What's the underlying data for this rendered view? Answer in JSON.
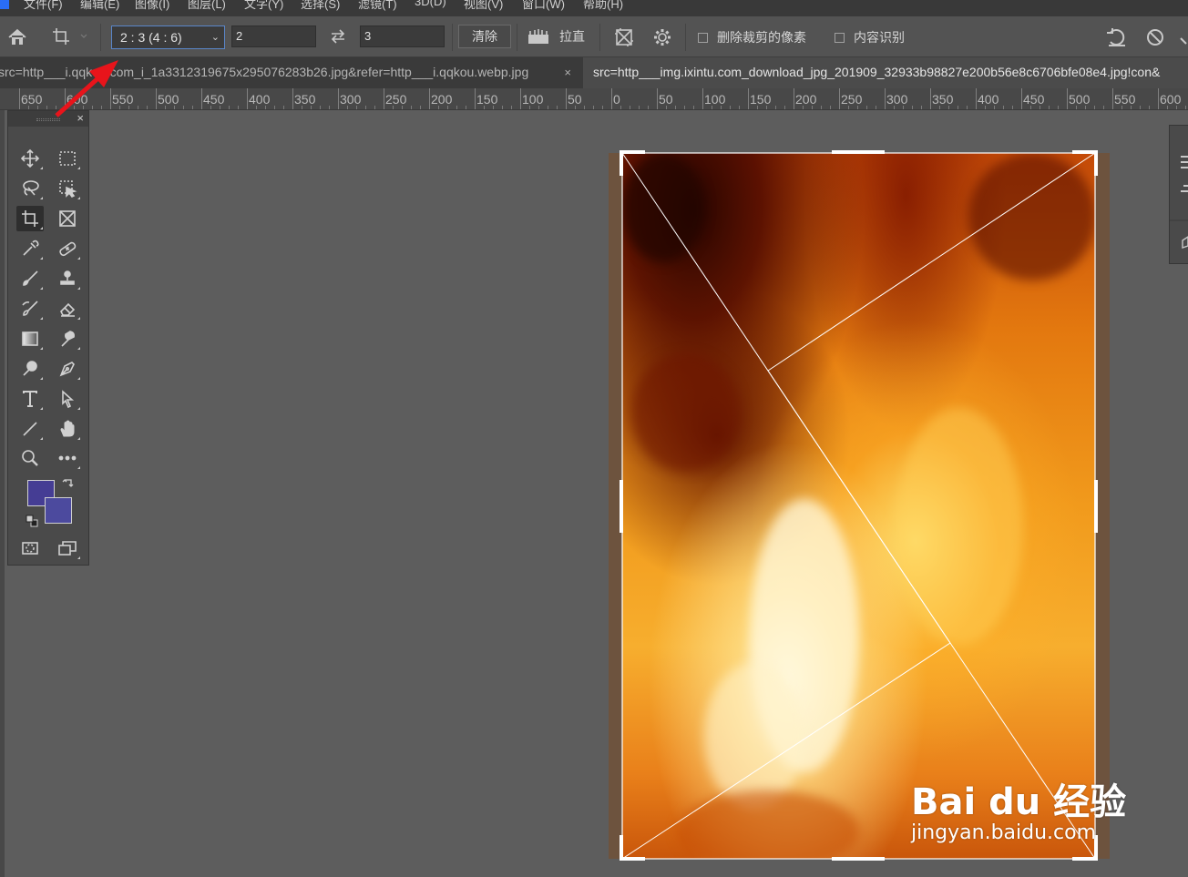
{
  "menubar": {
    "items": [
      "文件(F)",
      "编辑(E)",
      "图像(I)",
      "图层(L)",
      "文字(Y)",
      "选择(S)",
      "滤镜(T)",
      "3D(D)",
      "视图(V)",
      "窗口(W)",
      "帮助(H)"
    ]
  },
  "options": {
    "ratio_preset": "2 : 3 (4 : 6)",
    "width_value": "2",
    "height_value": "3",
    "clear_label": "清除",
    "straighten_label": "拉直",
    "delete_cropped_label": "删除裁剪的像素",
    "content_aware_label": "内容识别",
    "delete_cropped_checked": false,
    "content_aware_checked": false
  },
  "tabs": [
    {
      "label": "src=http___i.qqkou.com_i_1a3312319675x295076283b26.jpg&refer=http___i.qqkou.webp.jpg",
      "close": "×",
      "active": false
    },
    {
      "label": "src=http___img.ixintu.com_download_jpg_201909_32933b98827e200b56e8c6706bfe08e4.jpg!con&",
      "active": true
    }
  ],
  "ruler": {
    "labels": [
      "650",
      "600",
      "550",
      "500",
      "450",
      "400",
      "350",
      "300",
      "250",
      "200",
      "150",
      "100",
      "50",
      "0",
      "50",
      "100",
      "150",
      "200",
      "250",
      "300",
      "350",
      "400",
      "450",
      "500",
      "550",
      "600"
    ]
  },
  "tools": {
    "panel_close": "×"
  },
  "colors": {
    "foreground": "#453d94",
    "background": "#4c4a9e",
    "annotation_arrow": "#e8141b"
  },
  "watermark": {
    "brand": "Bai du 经验",
    "url": "jingyan.baidu.com"
  }
}
